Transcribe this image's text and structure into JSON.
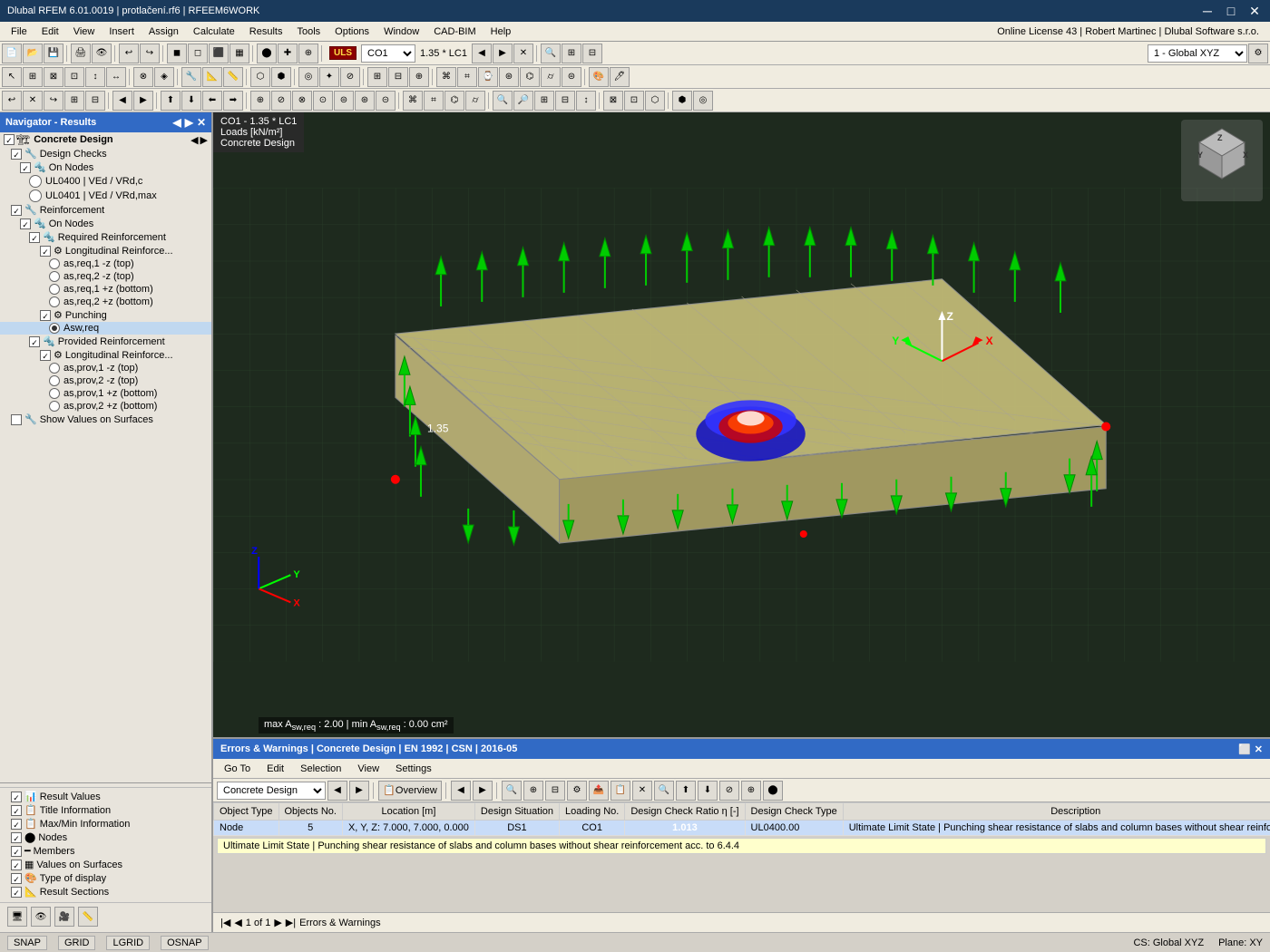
{
  "title_bar": {
    "title": "Dlubal RFEM 6.01.0019 | protlačení.rf6 | RFEEM6WORK",
    "minimize": "─",
    "maximize": "□",
    "close": "✕"
  },
  "menu": {
    "items": [
      "File",
      "Edit",
      "View",
      "Insert",
      "Assign",
      "Calculate",
      "Results",
      "Tools",
      "Options",
      "Window",
      "CAD-BIM",
      "Help"
    ]
  },
  "toolbar3": {
    "license_info": "Online License 43 | Robert Martinec | Dlubal Software s.r.o.",
    "dropdown_value": "1 - Global XYZ"
  },
  "load_combo": {
    "label": "ULS",
    "value": "CO1",
    "formula": "1.35 * LC1"
  },
  "navigator": {
    "title": "Navigator - Results",
    "concrete_design_label": "Concrete Design",
    "items": [
      {
        "id": "design-checks",
        "label": "Design Checks",
        "indent": 1,
        "checked": true,
        "type": "group"
      },
      {
        "id": "on-nodes",
        "label": "On Nodes",
        "indent": 2,
        "checked": true,
        "type": "group"
      },
      {
        "id": "ul0400",
        "label": "UL0400 | VEd / VRd,c",
        "indent": 3,
        "type": "leaf"
      },
      {
        "id": "ul0401",
        "label": "UL0401 | VEd / VRd,max",
        "indent": 3,
        "type": "leaf"
      },
      {
        "id": "reinforcement",
        "label": "Reinforcement",
        "indent": 1,
        "checked": true,
        "type": "group"
      },
      {
        "id": "on-nodes2",
        "label": "On Nodes",
        "indent": 2,
        "checked": true,
        "type": "group"
      },
      {
        "id": "required-reinf",
        "label": "Required Reinforcement",
        "indent": 3,
        "checked": true,
        "type": "group"
      },
      {
        "id": "long-reinf1",
        "label": "Longitudinal Reinforce...",
        "indent": 4,
        "checked": true,
        "type": "group"
      },
      {
        "id": "as-req1-top",
        "label": "as,req,1 -z (top)",
        "indent": 5,
        "type": "radio"
      },
      {
        "id": "as-req2-top",
        "label": "as,req,2 -z (top)",
        "indent": 5,
        "type": "radio"
      },
      {
        "id": "as-req1-bot",
        "label": "as,req,1 +z (bottom)",
        "indent": 5,
        "type": "radio"
      },
      {
        "id": "as-req2-bot",
        "label": "as,req,2 +z (bottom)",
        "indent": 5,
        "type": "radio"
      },
      {
        "id": "punching",
        "label": "Punching",
        "indent": 4,
        "checked": true,
        "type": "group"
      },
      {
        "id": "asw-req",
        "label": "Asw,req",
        "indent": 5,
        "type": "radio",
        "selected": true
      },
      {
        "id": "prov-reinf",
        "label": "Provided Reinforcement",
        "indent": 3,
        "checked": true,
        "type": "group"
      },
      {
        "id": "long-reinf2",
        "label": "Longitudinal Reinforce...",
        "indent": 4,
        "checked": true,
        "type": "group"
      },
      {
        "id": "as-prov1-top",
        "label": "as,prov,1 -z (top)",
        "indent": 5,
        "type": "radio"
      },
      {
        "id": "as-prov2-top",
        "label": "as,prov,2 -z (top)",
        "indent": 5,
        "type": "radio"
      },
      {
        "id": "as-prov1-bot",
        "label": "as,prov,1 +z (bottom)",
        "indent": 5,
        "type": "radio"
      },
      {
        "id": "as-prov2-bot",
        "label": "as,prov,2 +z (bottom)",
        "indent": 5,
        "type": "radio"
      },
      {
        "id": "show-values",
        "label": "Show Values on Surfaces",
        "indent": 1,
        "type": "checkbox"
      }
    ]
  },
  "bottom_nav": {
    "items": [
      {
        "id": "result-values",
        "label": "Result Values",
        "checked": true
      },
      {
        "id": "title-info",
        "label": "Title Information",
        "checked": true
      },
      {
        "id": "maxmin-info",
        "label": "Max/Min Information",
        "checked": true
      },
      {
        "id": "nodes",
        "label": "Nodes",
        "checked": true
      },
      {
        "id": "members",
        "label": "Members",
        "checked": true
      },
      {
        "id": "values-surfaces",
        "label": "Values on Surfaces",
        "checked": true
      },
      {
        "id": "type-display",
        "label": "Type of display",
        "checked": true
      },
      {
        "id": "result-sections",
        "label": "Result Sections",
        "checked": true
      }
    ]
  },
  "viewport": {
    "line1": "CO1 - 1.35 * LC1",
    "line2": "Loads [kN/m²]",
    "line3": "Concrete Design",
    "status_text": "max Asw,req : 2.00 | min Asw,req : 0.00 cm²"
  },
  "errors_panel": {
    "title": "Errors & Warnings | Concrete Design | EN 1992 | CSN | 2016-05",
    "menu_items": [
      "Go To",
      "Edit",
      "Selection",
      "View",
      "Settings"
    ],
    "dropdown_value": "Concrete Design",
    "overview_label": "Overview",
    "columns": [
      "Object Type",
      "Objects No.",
      "Location [m]",
      "Design Situation",
      "Loading No.",
      "Design Check Ratio η [-]",
      "Design Check Type",
      "Description"
    ],
    "rows": [
      {
        "obj_type": "Node",
        "obj_no": "5",
        "location": "X, Y, Z: 7.000, 7.000, 0.000",
        "design_sit": "DS1",
        "loading": "CO1",
        "ratio": "1.013",
        "check_type": "UL0400.00",
        "description": "Ultimate Limit State | Punching shear resistance of slabs and column bases without shear reinforcem..."
      }
    ],
    "tooltip": "Ultimate Limit State | Punching shear resistance of slabs and column bases without shear reinforcement acc. to 6.4.4",
    "footer_page": "1 of 1",
    "footer_label": "Errors & Warnings"
  },
  "status_bar": {
    "snap": "SNAP",
    "grid": "GRID",
    "lgrid": "LGRID",
    "osnap": "OSNAP",
    "cs": "CS: Global XYZ",
    "plane": "Plane: XY"
  }
}
